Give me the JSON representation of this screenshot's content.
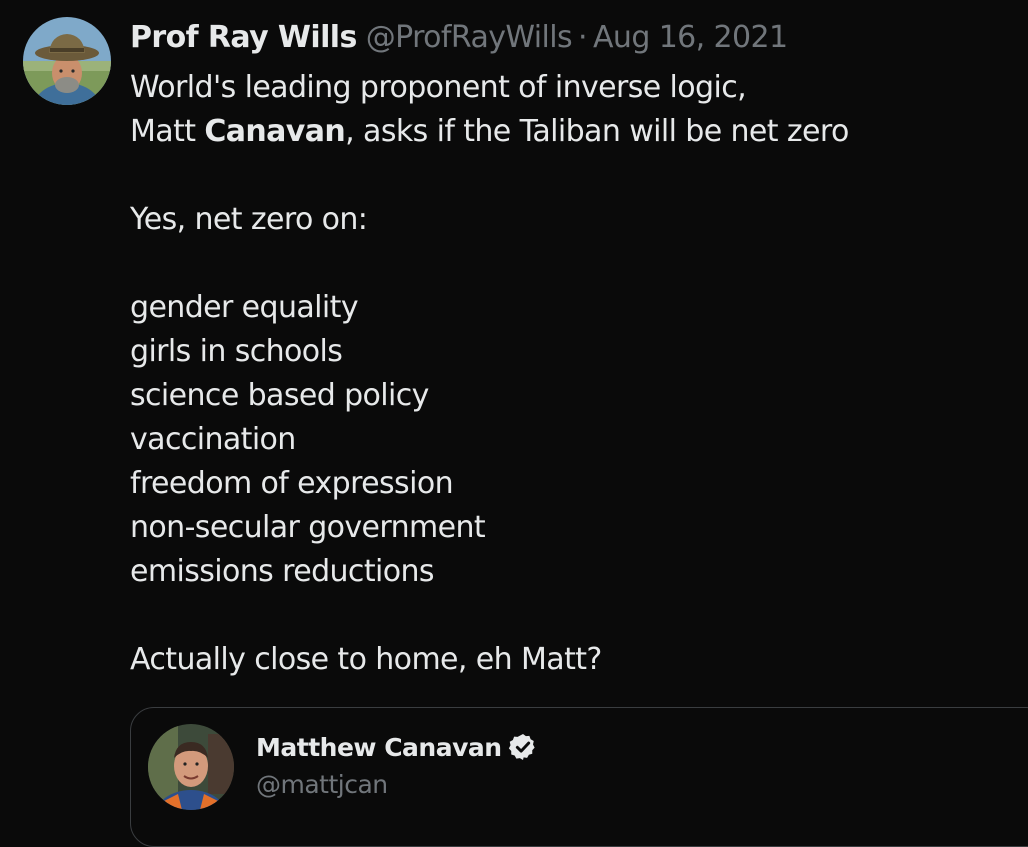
{
  "tweet": {
    "author": {
      "display_name": "Prof Ray Wills",
      "handle": "@ProfRayWills",
      "separator": "·",
      "date": "Aug 16, 2021",
      "avatar_icon": "profile-photo-man-in-hat"
    },
    "text": {
      "l1": "World's leading proponent of inverse logic,",
      "l2_pre": "Matt ",
      "l2_bold": "Canavan",
      "l2_post": ", asks if the Taliban will be net zero",
      "l4": "Yes, net zero on:",
      "l6": "gender equality",
      "l7": "girls in schools",
      "l8": "science based policy",
      "l9": "vaccination",
      "l10": "freedom of expression",
      "l11": "non-secular government",
      "l12": "emissions reductions",
      "l14": "Actually close to home, eh Matt?"
    },
    "quoted": {
      "display_name": "Matthew Canavan",
      "handle": "@mattjcan",
      "verified_icon": "verified-badge-icon",
      "avatar_icon": "profile-photo-man-hi-vis"
    }
  },
  "colors": {
    "background": "#0a0a0a",
    "primary_text": "#e7e9ea",
    "secondary_text": "#71767b",
    "card_border": "#3a3d40"
  }
}
